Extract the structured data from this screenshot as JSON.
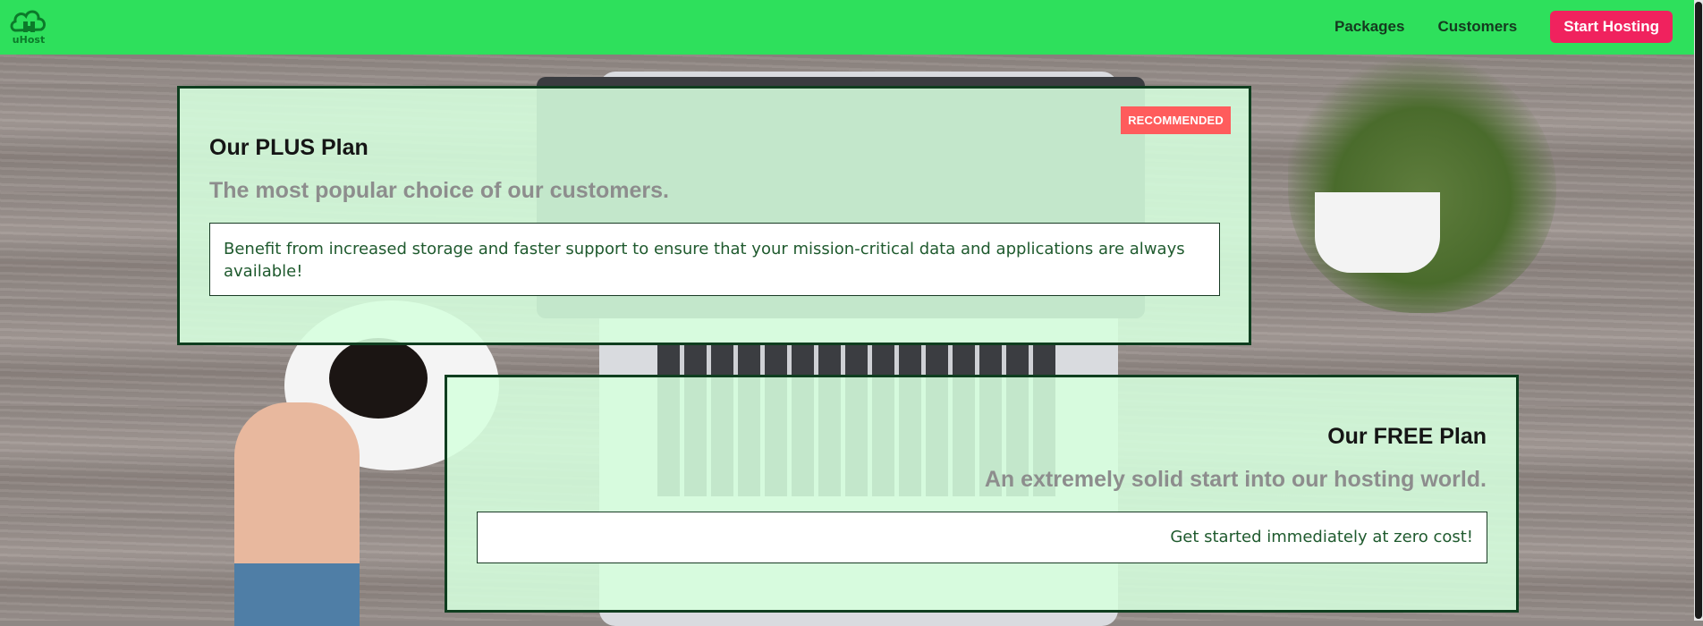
{
  "brand": {
    "logo_text": "uHost",
    "color": "#2ee05c"
  },
  "nav": {
    "items": [
      {
        "label": "Packages"
      },
      {
        "label": "Customers"
      }
    ],
    "cta_label": "Start Hosting",
    "cta_color": "#f0225e"
  },
  "plans": [
    {
      "badge": "RECOMMENDED",
      "title": "Our PLUS Plan",
      "subtitle": "The most popular choice of our customers.",
      "description": "Benefit from increased storage and faster support to ensure that your mission-critical data and applications are always available!"
    },
    {
      "title": "Our FREE Plan",
      "subtitle": "An extremely solid start into our hosting world.",
      "description": "Get started immediately at zero cost!"
    }
  ],
  "colors": {
    "card_bg": "#d6ffde",
    "card_border": "#0f3e1f",
    "badge_bg": "#ff5c5c"
  }
}
